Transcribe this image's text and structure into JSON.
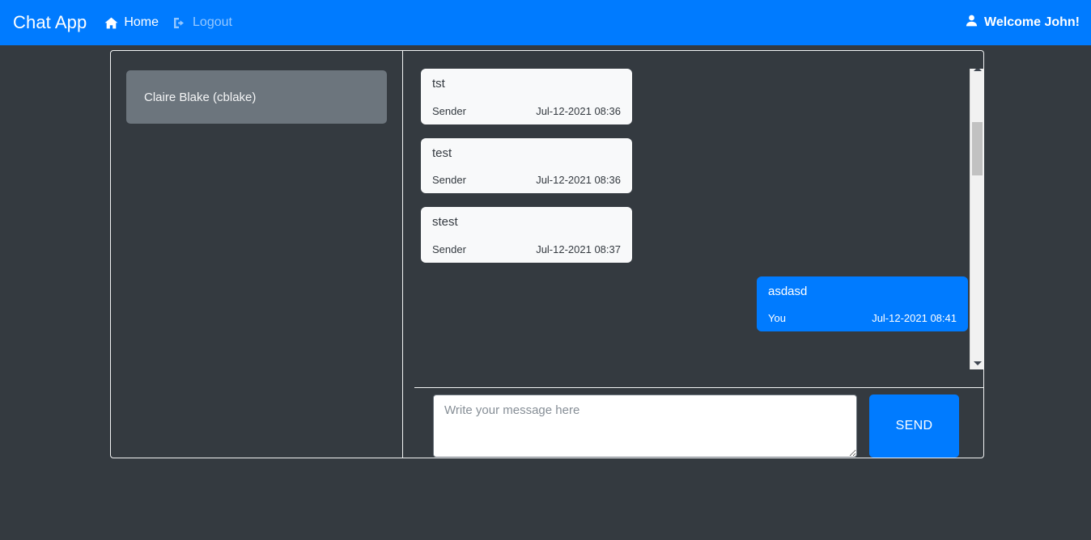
{
  "navbar": {
    "brand": "Chat App",
    "links": [
      {
        "label": "Home",
        "icon": "home-icon",
        "active": true
      },
      {
        "label": "Logout",
        "icon": "logout-icon",
        "active": false
      }
    ],
    "welcome": "Welcome John!",
    "welcome_icon": "user-icon",
    "background_color": "#007bff"
  },
  "contacts": {
    "items": [
      {
        "label": "Claire Blake (cblake)",
        "selected": true
      }
    ],
    "selected_color": "#6c757d"
  },
  "chat": {
    "messages": [
      {
        "body": "tst",
        "sender": "Sender",
        "timestamp": "Jul-12-2021 08:36",
        "direction": "incoming"
      },
      {
        "body": "test",
        "sender": "Sender",
        "timestamp": "Jul-12-2021 08:36",
        "direction": "incoming"
      },
      {
        "body": "stest",
        "sender": "Sender",
        "timestamp": "Jul-12-2021 08:37",
        "direction": "incoming"
      },
      {
        "body": "asdasd",
        "sender": "You",
        "timestamp": "Jul-12-2021 08:41",
        "direction": "outgoing"
      }
    ],
    "incoming_color": "#f8f9fa",
    "outgoing_color": "#007bff"
  },
  "composer": {
    "placeholder": "Write your message here",
    "value": "",
    "send_label": "SEND"
  },
  "scrollbar": {
    "up_icon": "caret-up-icon",
    "down_icon": "caret-down-icon"
  },
  "theme": {
    "page_background": "#343a40",
    "accent": "#007bff",
    "border": "#f2f3f4"
  }
}
